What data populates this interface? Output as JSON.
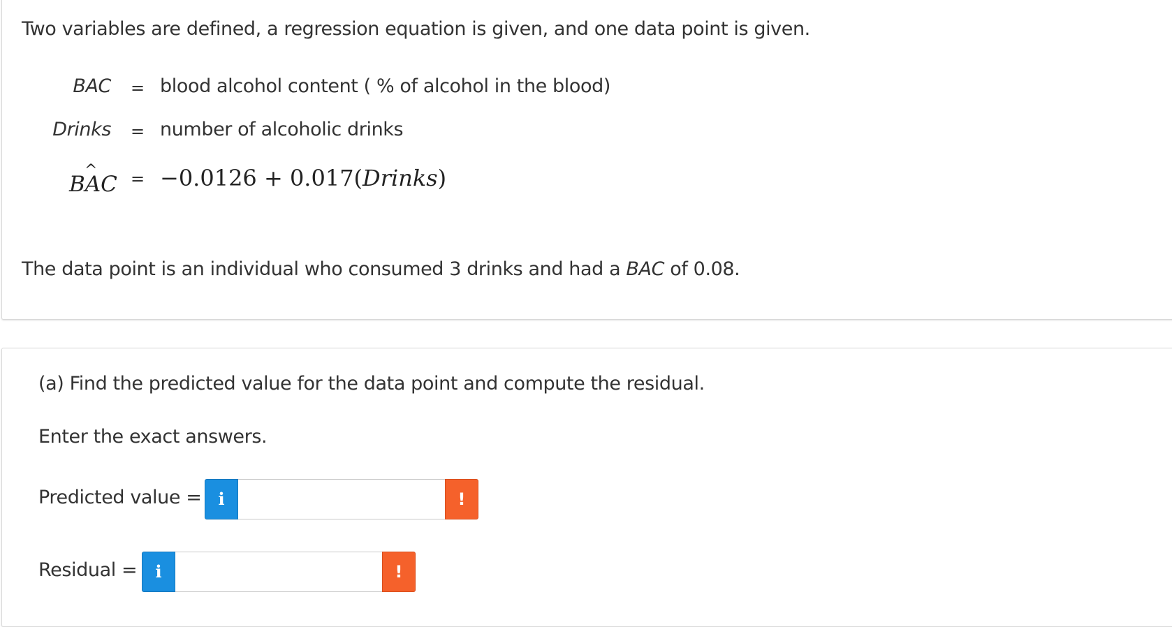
{
  "intro": {
    "text": "Two variables are defined, a regression equation is given, and one data point is given.",
    "definitions": [
      {
        "name": "BAC",
        "eq": "=",
        "desc": "blood alcohol content ( % of alcohol in the blood)"
      },
      {
        "name": "Drinks",
        "eq": "=",
        "desc": "number of alcoholic drinks"
      }
    ],
    "regression": {
      "name": "BAC",
      "hat": "^",
      "eq": "=",
      "equation_prefix": "−0.0126 + 0.017(",
      "equation_var": "Drinks",
      "equation_suffix": ")"
    },
    "data_point": {
      "prefix": "The data point is an individual who consumed 3 drinks and had a ",
      "var": "BAC",
      "suffix": " of 0.08."
    }
  },
  "part_a": {
    "question": "(a) Find the predicted value for the data point and compute the residual.",
    "instruction": "Enter the exact answers.",
    "predicted": {
      "label": "Predicted value =",
      "info_icon": "i",
      "warn_icon": "!",
      "value": ""
    },
    "residual": {
      "label": "Residual =",
      "info_icon": "i",
      "warn_icon": "!",
      "value": ""
    }
  },
  "colors": {
    "info": "#1a8fe0",
    "warning": "#f5612b",
    "text": "#333333",
    "border": "#d9d9d9"
  }
}
